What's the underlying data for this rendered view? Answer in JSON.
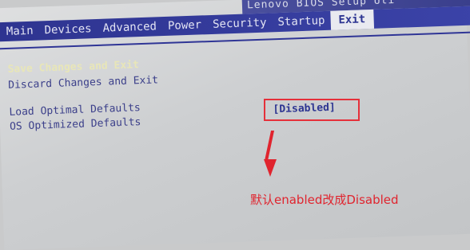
{
  "header": {
    "title": "Lenovo BIOS Setup Uti"
  },
  "menu": [
    {
      "label": "Main"
    },
    {
      "label": "Devices"
    },
    {
      "label": "Advanced"
    },
    {
      "label": "Power"
    },
    {
      "label": "Security"
    },
    {
      "label": "Startup"
    },
    {
      "label": "Exit",
      "active": true
    }
  ],
  "options": [
    {
      "label": "Save Changes and Exit"
    },
    {
      "label": "Discard Changes and Exit"
    },
    {
      "label": "Load Optimal Defaults"
    },
    {
      "label": "OS Optimized Defaults"
    }
  ],
  "os_optimized_value": "[Disabled]",
  "annotation": {
    "text": "默认enabled改成Disabled",
    "color": "#e0242e"
  },
  "colors": {
    "menubar": "#2e3490",
    "active_tab_bg": "#e9eaf0",
    "screen_bg": "#d3d4d6"
  }
}
